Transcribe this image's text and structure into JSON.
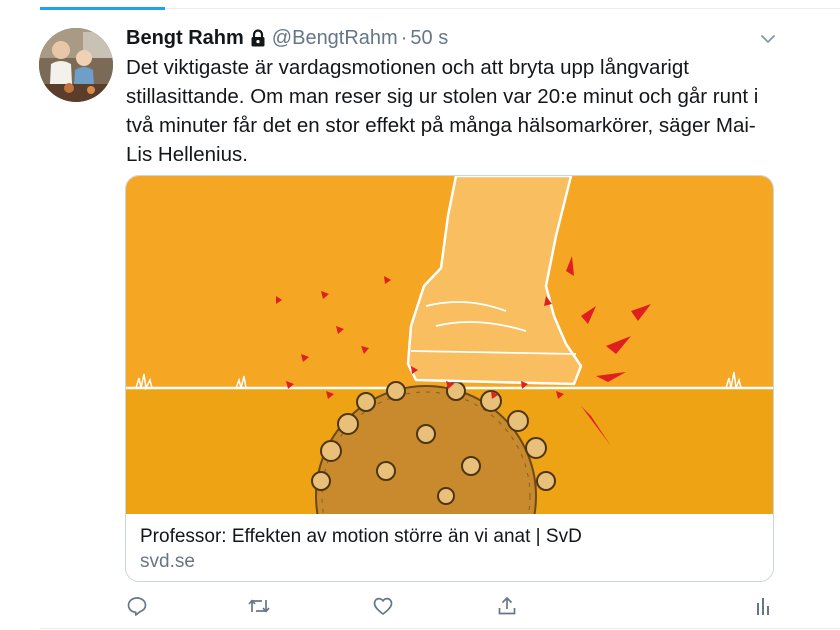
{
  "tweet": {
    "author_name": "Bengt Rahm",
    "handle": "@BengtRahm",
    "separator": "·",
    "time": "50 s",
    "text_lines": [
      "Det viktigaste är vardagsmotionen och att bryta upp långvarigt",
      "stillasittande. Om man reser sig ur stolen var 20:e minut och går runt i",
      "två minuter får det en stor effekt på många hälsomarkörer, säger Mai-",
      "Lis Hellenius."
    ],
    "card": {
      "title": "Professor: Effekten av motion större än vi anat | SvD",
      "domain": "svd.se"
    },
    "actions": [
      "reply-icon",
      "retweet-icon",
      "like-icon",
      "share-icon",
      "analytics-icon"
    ],
    "colors": {
      "accent": "#1da1f2",
      "secondary_text": "#657786",
      "card_orange": "#f5a623",
      "ground_orange": "#eea315"
    }
  }
}
